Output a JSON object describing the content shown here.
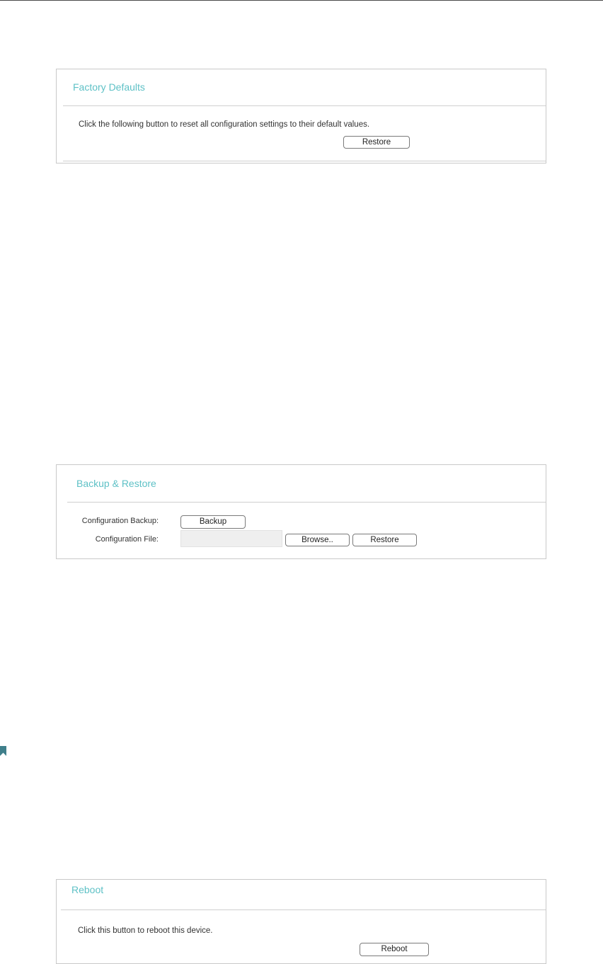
{
  "factory_defaults": {
    "title": "Factory Defaults",
    "description": "Click the following button to reset all configuration settings to their default values.",
    "restore_label": "Restore"
  },
  "backup_restore": {
    "title": "Backup & Restore",
    "backup_label_text": "Configuration Backup:",
    "backup_button": "Backup",
    "file_label_text": "Configuration File:",
    "file_value": "",
    "browse_button": "Browse..",
    "restore_button": "Restore"
  },
  "reboot": {
    "title": "Reboot",
    "description": "Click this button to reboot this device.",
    "reboot_button": "Reboot"
  },
  "colors": {
    "title_accent": "#5ec1c6",
    "bookmark": "#3f7f8b"
  },
  "icons": {
    "bookmark": "bookmark-icon"
  }
}
